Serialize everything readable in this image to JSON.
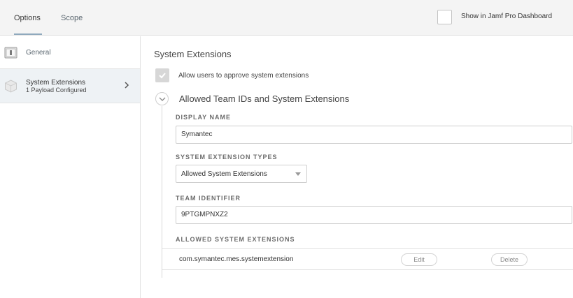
{
  "topbar": {
    "tabs": [
      {
        "label": "Options",
        "active": true
      },
      {
        "label": "Scope",
        "active": false
      }
    ],
    "dashboard_label": "Show in Jamf Pro Dashboard",
    "dashboard_checked": false
  },
  "sidebar": {
    "items": [
      {
        "label": "General",
        "icon": "general-payload-icon"
      },
      {
        "label": "System Extensions",
        "sublabel": "1 Payload Configured",
        "icon": "system-extensions-payload-icon",
        "selected": true
      }
    ]
  },
  "main": {
    "section_title": "System Extensions",
    "approve_label": "Allow users to approve system extensions",
    "approve_checked": true,
    "group_title": "Allowed Team IDs and System Extensions",
    "display_name_label": "DISPLAY NAME",
    "display_name_value": "Symantec",
    "extension_types_label": "SYSTEM EXTENSION TYPES",
    "extension_types_value": "Allowed System Extensions",
    "team_identifier_label": "TEAM IDENTIFIER",
    "team_identifier_value": "9PTGMPNXZ2",
    "allowed_extensions_label": "ALLOWED SYSTEM EXTENSIONS",
    "allowed_extensions": [
      {
        "value": "com.symantec.mes.systemextension",
        "edit_label": "Edit",
        "delete_label": "Delete"
      }
    ]
  },
  "colors": {
    "tab_underline": "#8fa9bd",
    "selected_sidebar_bg": "#eef2f5",
    "topbar_bg": "#f4f4f4"
  }
}
